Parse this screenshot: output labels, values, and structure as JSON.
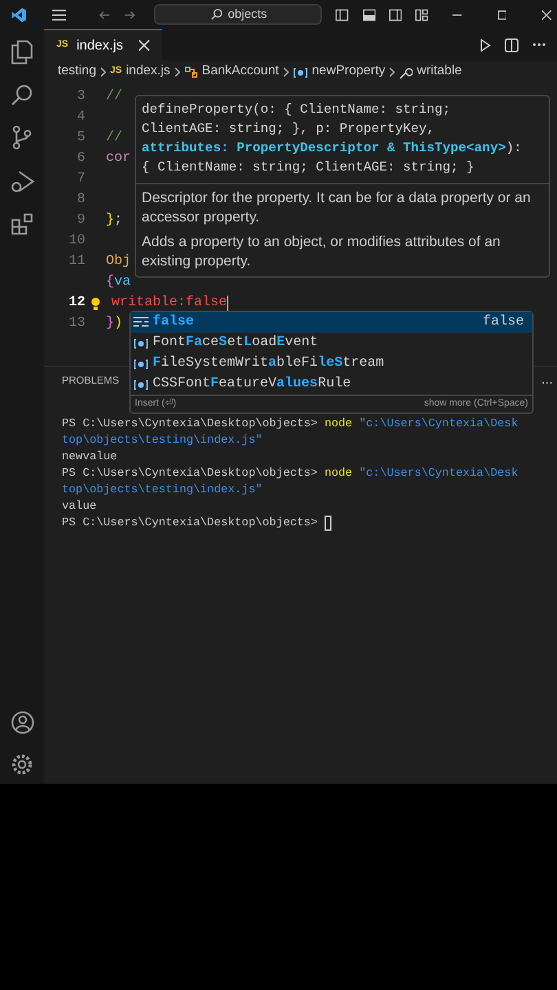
{
  "title_bar": {
    "search": "objects"
  },
  "tabs": [
    {
      "label": "index.js",
      "badge": "JS",
      "selected": true
    }
  ],
  "breadcrumbs": [
    {
      "kind": "folder",
      "label": "testing"
    },
    {
      "kind": "file",
      "badge": "JS",
      "label": "index.js"
    },
    {
      "kind": "class",
      "label": "BankAccount"
    },
    {
      "kind": "variable",
      "label": "newProperty"
    },
    {
      "kind": "property",
      "label": "writable"
    }
  ],
  "code_lines": [
    {
      "number": "3",
      "current": false,
      "tokens": [
        {
          "kind": "comment",
          "text": "//"
        }
      ]
    },
    {
      "number": "4",
      "current": false
    },
    {
      "number": "5",
      "current": false,
      "tokens": [
        {
          "kind": "comment",
          "text": "//"
        }
      ]
    },
    {
      "number": "6",
      "current": false,
      "tokens": [
        {
          "kind": "keyword",
          "text": "cor"
        }
      ]
    },
    {
      "number": "7",
      "current": false
    },
    {
      "number": "8",
      "current": false
    },
    {
      "number": "9",
      "current": false,
      "tokens": [
        {
          "kind": "bracket",
          "text": "}"
        },
        {
          "kind": "plain",
          "text": ";"
        }
      ]
    },
    {
      "number": "10",
      "current": false
    },
    {
      "number": "11",
      "current": false,
      "tokens": [
        {
          "kind": "class",
          "text": "Obj"
        }
      ]
    },
    {
      "current": false,
      "tokens": [
        {
          "kind": "bracket2",
          "text": "{"
        },
        {
          "kind": "variable",
          "text": "va"
        }
      ]
    },
    {
      "number": "12",
      "current": true,
      "lightbulb": true,
      "tokens": [
        {
          "kind": "property",
          "text": "writable"
        },
        {
          "kind": "property",
          "text": ":"
        },
        {
          "kind": "property",
          "text": "false"
        }
      ]
    },
    {
      "number": "13",
      "current": false,
      "tokens": [
        {
          "kind": "bracket2",
          "text": "}"
        },
        {
          "kind": "bracket",
          "text": ")"
        }
      ]
    }
  ],
  "hover": {
    "signature": [
      [
        {
          "kind": "plain",
          "text": "defineProperty(o: { ClientName: string;"
        }
      ],
      [
        {
          "kind": "plain",
          "text": "ClientAGE: string; }, p: PropertyKey,"
        }
      ],
      [
        {
          "kind": "param",
          "text": "attributes: PropertyDescriptor & ThisType<any>"
        },
        {
          "kind": "plain",
          "text": "):"
        }
      ],
      [
        {
          "kind": "plain",
          "text": "{ ClientName: string; ClientAGE: string; }"
        }
      ]
    ],
    "param_doc": "Descriptor for the property. It can be for a data property or an accessor property.",
    "doc": "Adds a property to an object, or modifies attributes of an existing property."
  },
  "suggestions": [
    {
      "kind": "keyword",
      "selected": true,
      "detail": "false",
      "parts": [
        {
          "text": "false",
          "match": true
        }
      ]
    },
    {
      "kind": "variable",
      "selected": false,
      "parts": [
        {
          "text": "Font",
          "match": false
        },
        {
          "text": "Fa",
          "match": true
        },
        {
          "text": "ce",
          "match": false
        },
        {
          "text": "S",
          "match": true
        },
        {
          "text": "et",
          "match": false
        },
        {
          "text": "L",
          "match": true
        },
        {
          "text": "oad",
          "match": false
        },
        {
          "text": "E",
          "match": true
        },
        {
          "text": "vent",
          "match": false
        }
      ]
    },
    {
      "kind": "variable",
      "selected": false,
      "parts": [
        {
          "text": "F",
          "match": true
        },
        {
          "text": "ileSystemWrit",
          "match": false
        },
        {
          "text": "a",
          "match": true
        },
        {
          "text": "bleFi",
          "match": false
        },
        {
          "text": "leS",
          "match": true
        },
        {
          "text": "tream",
          "match": false
        }
      ]
    },
    {
      "kind": "variable",
      "selected": false,
      "parts": [
        {
          "text": "CSSFont",
          "match": false
        },
        {
          "text": "F",
          "match": true
        },
        {
          "text": "eatureV",
          "match": false
        },
        {
          "text": "alues",
          "match": true
        },
        {
          "text": "Rule",
          "match": false
        }
      ]
    }
  ],
  "suggest_footer": {
    "left": "Insert (⏎)",
    "right": "show more (Ctrl+Space)"
  },
  "panel": {
    "tabs": [
      {
        "label": "PROBLEMS",
        "selected": false
      }
    ],
    "more": "..."
  },
  "terminal": [
    [
      {
        "kind": "prompt",
        "text": "PS C:\\Users\\Cyntexia\\Desktop\\objects> "
      },
      {
        "kind": "command",
        "text": "node"
      },
      {
        "kind": "string",
        "text": " \"c:\\Users\\Cyntexia\\Desk"
      }
    ],
    [
      {
        "kind": "string",
        "text": "top\\objects\\testing\\index.js\""
      }
    ],
    [
      {
        "kind": "plain",
        "text": "newvalue"
      }
    ],
    [
      {
        "kind": "prompt",
        "text": "PS C:\\Users\\Cyntexia\\Desktop\\objects> "
      },
      {
        "kind": "command",
        "text": "node"
      },
      {
        "kind": "string",
        "text": " \"c:\\Users\\Cyntexia\\Desk"
      }
    ],
    [
      {
        "kind": "string",
        "text": "top\\objects\\testing\\index.js\""
      }
    ],
    [
      {
        "kind": "plain",
        "text": "value"
      }
    ],
    [
      {
        "kind": "prompt",
        "text": "PS C:\\Users\\Cyntexia\\Desktop\\objects> "
      },
      {
        "kind": "cursor"
      }
    ]
  ]
}
